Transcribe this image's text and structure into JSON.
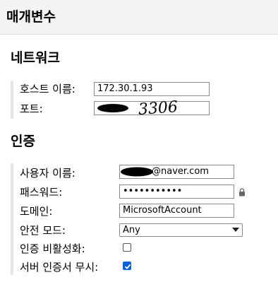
{
  "header": {
    "title": "매개변수"
  },
  "network": {
    "title": "네트워크",
    "host": {
      "label": "호스트 이름:",
      "value": "172.30.1.93"
    },
    "port": {
      "label": "포트:",
      "value": "",
      "handwritten": "3306"
    }
  },
  "auth": {
    "title": "인증",
    "username": {
      "label": "사용자 이름:",
      "value": "@naver.com"
    },
    "password": {
      "label": "패스워드:",
      "value": "•••••••••••",
      "icon": "lock-icon"
    },
    "domain": {
      "label": "도메인:",
      "value": "MicrosoftAccount"
    },
    "safe_mode": {
      "label": "안전 모드:",
      "value": "Any"
    },
    "disable_auth": {
      "label": "인증 비활성화:",
      "checked": false
    },
    "ignore_cert": {
      "label": "서버 인증서 무시:",
      "checked": true
    }
  },
  "colors": {
    "checkbox_checked": "#0b62d6",
    "header_bg": "#f3f3f3",
    "group_bar": "#e6e6e6"
  }
}
